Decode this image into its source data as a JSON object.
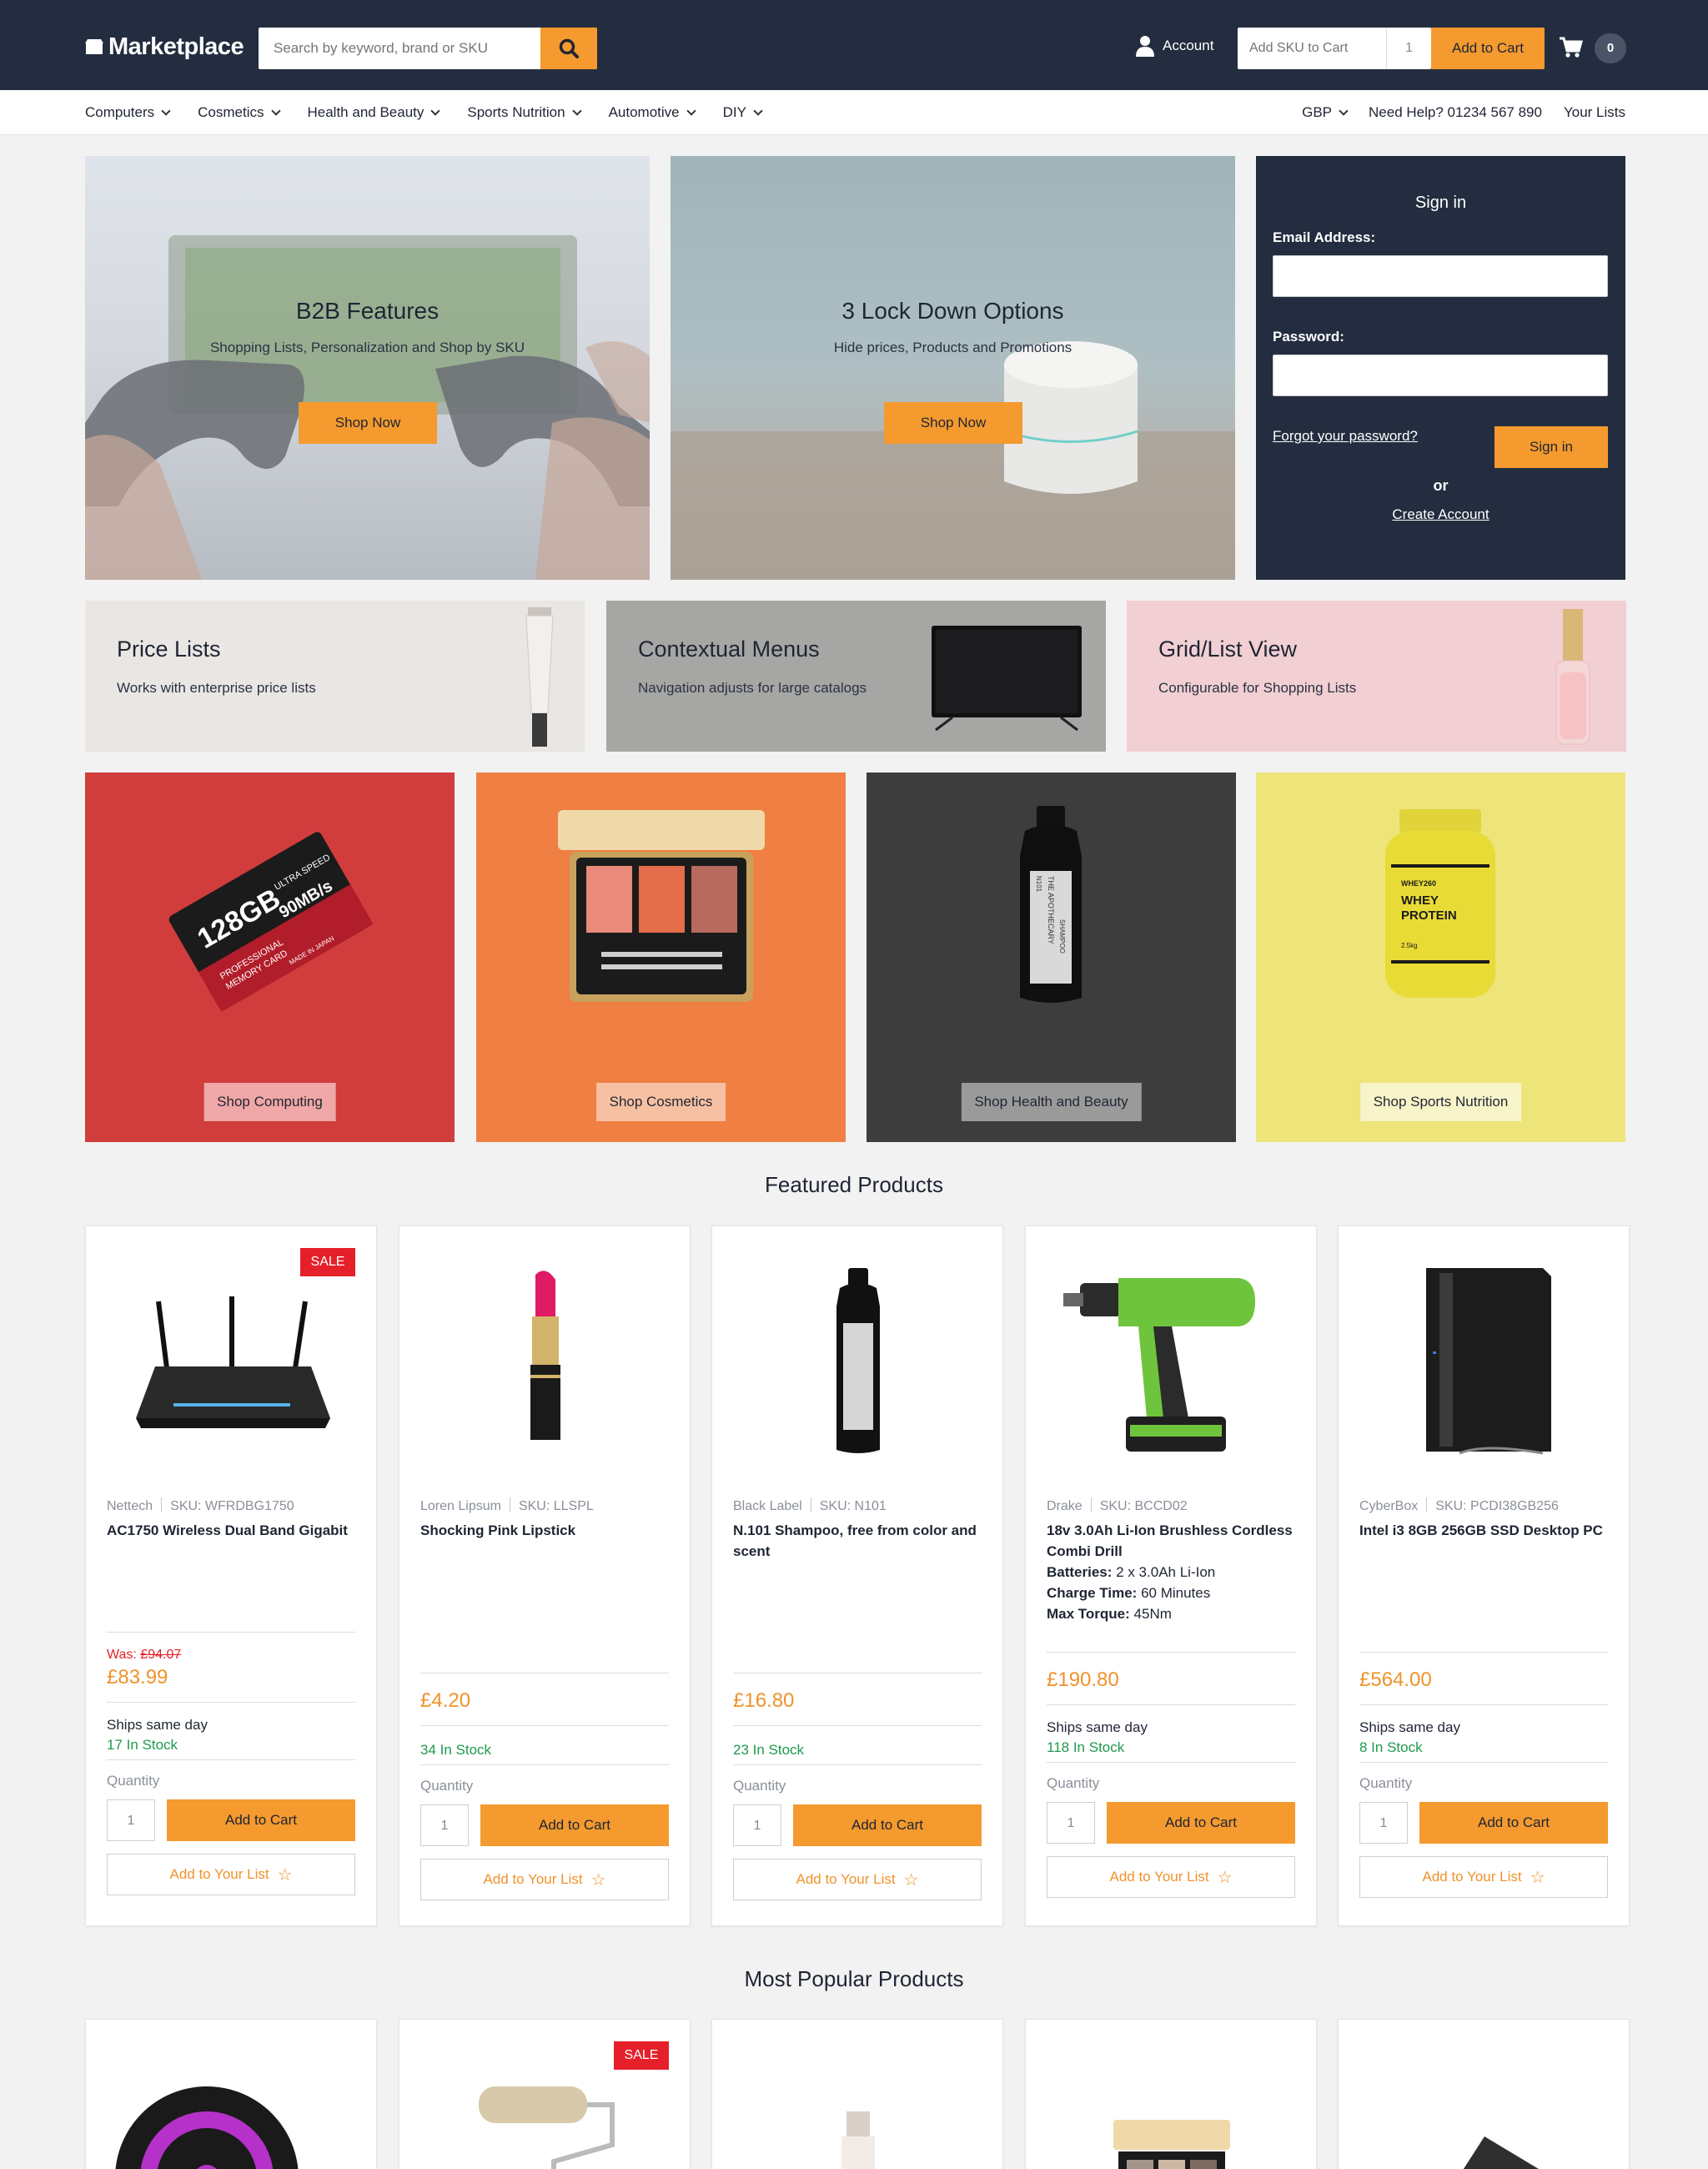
{
  "header": {
    "logo_text": "Marketplace",
    "search_placeholder": "Search by keyword, brand or SKU",
    "account_label": "Account",
    "sku_placeholder": "Add SKU to Cart",
    "sku_qty": "1",
    "add_to_cart_label": "Add to Cart",
    "cart_count": "0"
  },
  "nav": {
    "items": [
      "Computers",
      "Cosmetics",
      "Health and Beauty",
      "Sports Nutrition",
      "Automotive",
      "DIY"
    ],
    "currency": "GBP",
    "help": "Need Help? 01234 567 890",
    "lists": "Your Lists"
  },
  "hero": [
    {
      "title": "B2B Features",
      "subtitle": "Shopping Lists, Personalization and Shop by SKU",
      "button": "Shop Now"
    },
    {
      "title": "3 Lock Down Options",
      "subtitle": "Hide prices, Products and Promotions",
      "button": "Shop Now"
    }
  ],
  "signin": {
    "title": "Sign in",
    "email_label": "Email Address:",
    "password_label": "Password:",
    "forgot": "Forgot your password?",
    "button": "Sign in",
    "or": "or",
    "create": "Create Account"
  },
  "promos": [
    {
      "title": "Price Lists",
      "subtitle": "Works with enterprise price lists"
    },
    {
      "title": "Contextual Menus",
      "subtitle": "Navigation adjusts for large catalogs"
    },
    {
      "title": "Grid/List View",
      "subtitle": "Configurable for Shopping Lists"
    }
  ],
  "categories": [
    {
      "button": "Shop Computing",
      "color": "#d13c3c"
    },
    {
      "button": "Shop Cosmetics",
      "color": "#f07f44"
    },
    {
      "button": "Shop Health and Beauty",
      "color": "#3d3d3d"
    },
    {
      "button": "Shop Sports Nutrition",
      "color": "#ede57a"
    }
  ],
  "tile_text": {
    "memory_card": [
      "128GB",
      "ULTRA SPEED",
      "90MB/s",
      "PROFESSIONAL",
      "MEMORY CARD",
      "MADE IN JAPAN"
    ],
    "shampoo": [
      "THE APOTHECARY",
      "N101",
      "SHAMPOO"
    ],
    "protein": [
      "WHEY260",
      "WHEY",
      "PROTEIN",
      "2.5kg"
    ]
  },
  "featured_title": "Featured Products",
  "popular_title": "Most Popular Products",
  "labels": {
    "sale": "SALE",
    "was": "Was:",
    "ships": "Ships same day",
    "quantity": "Quantity",
    "qty_default": "1",
    "add_to_cart": "Add to Cart",
    "add_to_list": "Add to Your List"
  },
  "featured": [
    {
      "brand": "Nettech",
      "sku": "SKU: WFRDBG1750",
      "name": "AC1750 Wireless Dual Band Gigabit",
      "was": "£94.07",
      "price": "£83.99",
      "ships": true,
      "stock": "17 In Stock",
      "sale": true,
      "icon": "router-image"
    },
    {
      "brand": "Loren Lipsum",
      "sku": "SKU: LLSPL",
      "name": "Shocking Pink Lipstick",
      "price": "£4.20",
      "ships": false,
      "stock": "34 In Stock",
      "sale": false,
      "icon": "lipstick-image"
    },
    {
      "brand": "Black Label",
      "sku": "SKU: N101",
      "name": "N.101 Shampoo, free from color and scent",
      "price": "£16.80",
      "ships": false,
      "stock": "23 In Stock",
      "sale": false,
      "icon": "shampoo-image"
    },
    {
      "brand": "Drake",
      "sku": "SKU: BCCD02",
      "name": "18v 3.0Ah Li-Ion Brushless Cordless Combi Drill",
      "specs": [
        {
          "k": "Batteries:",
          "v": "2 x 3.0Ah Li-Ion"
        },
        {
          "k": "Charge Time:",
          "v": "60 Minutes"
        },
        {
          "k": "Max Torque:",
          "v": "45Nm"
        }
      ],
      "price": "£190.80",
      "ships": true,
      "stock": "118 In Stock",
      "sale": false,
      "icon": "drill-image"
    },
    {
      "brand": "CyberBox",
      "sku": "SKU: PCDI38GB256",
      "name": "Intel i3 8GB 256GB SSD Desktop PC",
      "price": "£564.00",
      "ships": true,
      "stock": "8 In Stock",
      "sale": false,
      "icon": "desktop-pc-image"
    }
  ],
  "popular": [
    {
      "sale": false,
      "icon": "alloy-wheel-image"
    },
    {
      "sale": true,
      "icon": "paint-roller-image"
    },
    {
      "sale": false,
      "icon": "serum-bottle-image"
    },
    {
      "sale": false,
      "icon": "eyeshadow-palette-image"
    },
    {
      "sale": false,
      "icon": "ssd-drive-image"
    }
  ]
}
